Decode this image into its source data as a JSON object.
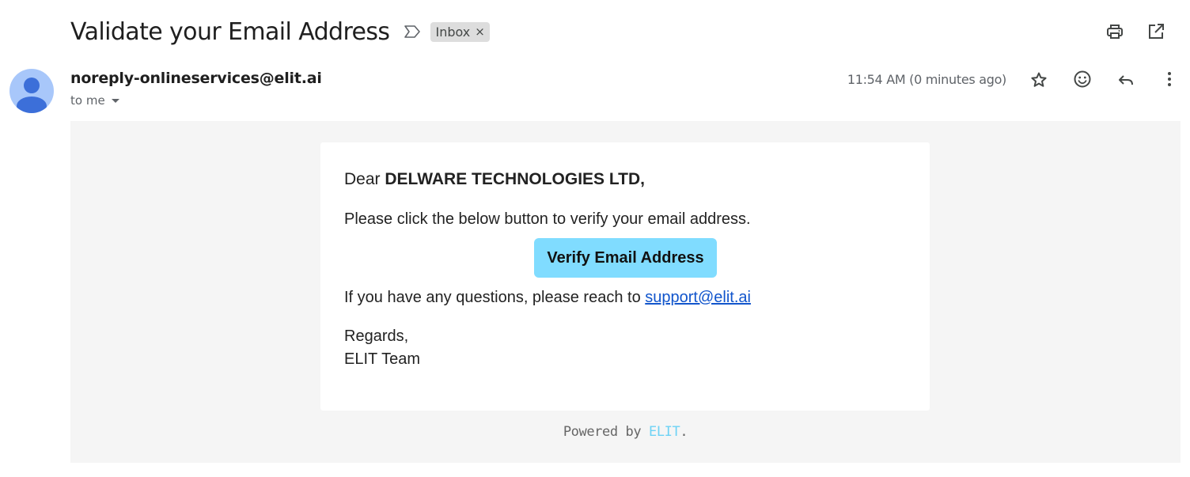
{
  "email": {
    "subject": "Validate your Email Address",
    "label": "Inbox",
    "label_remove": "×",
    "sender": "noreply-onlineservices@elit.ai",
    "to_me": "to me",
    "timestamp": "11:54 AM (0 minutes ago)"
  },
  "icons": {
    "importance": "importance-marker-icon",
    "print": "print-icon",
    "open_new_window": "open-in-new-window-icon",
    "star": "star-icon",
    "emoji": "emoji-reaction-icon",
    "reply": "reply-icon",
    "more": "more-vertical-icon",
    "avatar": "default-avatar-icon"
  },
  "body": {
    "greeting_prefix": "Dear ",
    "greeting_name": "DELWARE TECHNOLOGIES LTD,",
    "instruction": "Please click the below button to verify your email address.",
    "button_label": "Verify Email Address",
    "questions_prefix": "If you have any questions, please reach to ",
    "support_email": "support@elit.ai",
    "regards": "Regards,",
    "team": "ELIT Team"
  },
  "footer": {
    "powered_prefix": "Powered by ",
    "brand": "ELIT",
    "suffix": "."
  },
  "colors": {
    "button_bg": "#80dcff",
    "link": "#1155cc",
    "brand_accent": "#6dd2f5",
    "avatar_bg": "#a8c7fa",
    "avatar_fg": "#4a7de0",
    "message_bg": "#f5f5f5"
  }
}
